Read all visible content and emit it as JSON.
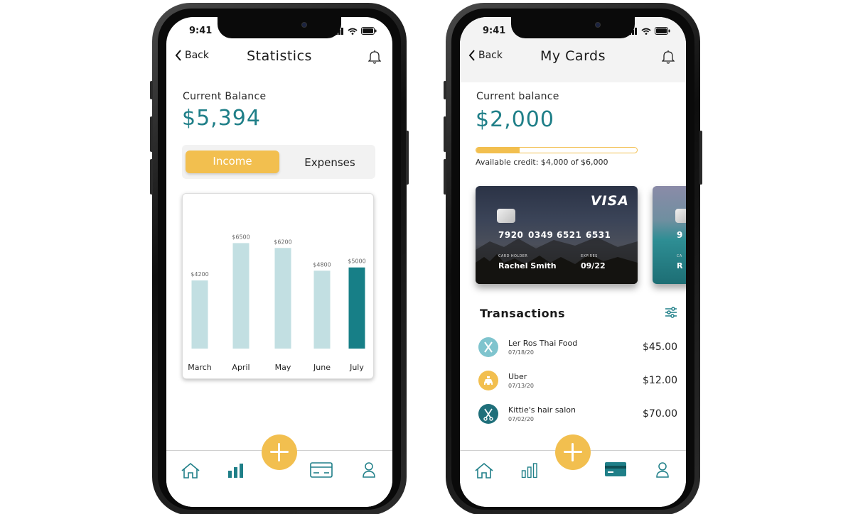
{
  "colors": {
    "teal": "#1f7f88",
    "teal_light": "#c2dfe2",
    "yellow": "#f2bf4f"
  },
  "left_phone": {
    "status_time": "9:41",
    "back_label": "Back",
    "title": "Statistics",
    "balance_label": "Current Balance",
    "balance_value": "$5,394",
    "toggle": {
      "active": "Income",
      "inactive": "Expenses"
    },
    "tabs": [
      "home-icon",
      "bar-chart-icon",
      "credit-card-icon",
      "user-icon"
    ]
  },
  "chart_data": {
    "type": "bar",
    "categories": [
      "March",
      "April",
      "May",
      "June",
      "July"
    ],
    "values": [
      4200,
      6500,
      6200,
      4800,
      5000
    ],
    "value_labels": [
      "$4200",
      "$6500",
      "$6200",
      "$4800",
      "$5000"
    ],
    "highlight_index": 4,
    "ylim": [
      0,
      7000
    ],
    "colors": {
      "default": "#c2dfe2",
      "highlight": "#177f87"
    }
  },
  "right_phone": {
    "status_time": "9:41",
    "back_label": "Back",
    "title": "My Cards",
    "balance_label": "Current balance",
    "balance_value": "$2,000",
    "credit_used_fraction": 0.27,
    "available_credit": "Available credit: $4,000 of $6,000",
    "card": {
      "brand": "VISA",
      "number_groups": [
        "7920",
        "0349",
        "6521",
        "6531"
      ],
      "holder_label": "CARD HOLDER",
      "holder_name": "Rachel Smith",
      "expires_label": "EXPIRES",
      "expires": "09/22"
    },
    "peek_card": {
      "number_fragment": "9",
      "holder_fragment": "R",
      "label_fragment": "CA"
    },
    "transactions_title": "Transactions",
    "transactions": [
      {
        "name": "Ler Ros Thai Food",
        "date": "07/18/20",
        "amount": "$45.00",
        "icon": "utensils-icon",
        "color": "#7fc4ce"
      },
      {
        "name": "Uber",
        "date": "07/13/20",
        "amount": "$12.00",
        "icon": "taxi-icon",
        "color": "#f2bf4f"
      },
      {
        "name": "Kittie's hair salon",
        "date": "07/02/20",
        "amount": "$70.00",
        "icon": "scissors-icon",
        "color": "#1f6f7a"
      }
    ],
    "tabs": [
      "home-icon",
      "bar-chart-icon",
      "credit-card-icon",
      "user-icon"
    ]
  }
}
